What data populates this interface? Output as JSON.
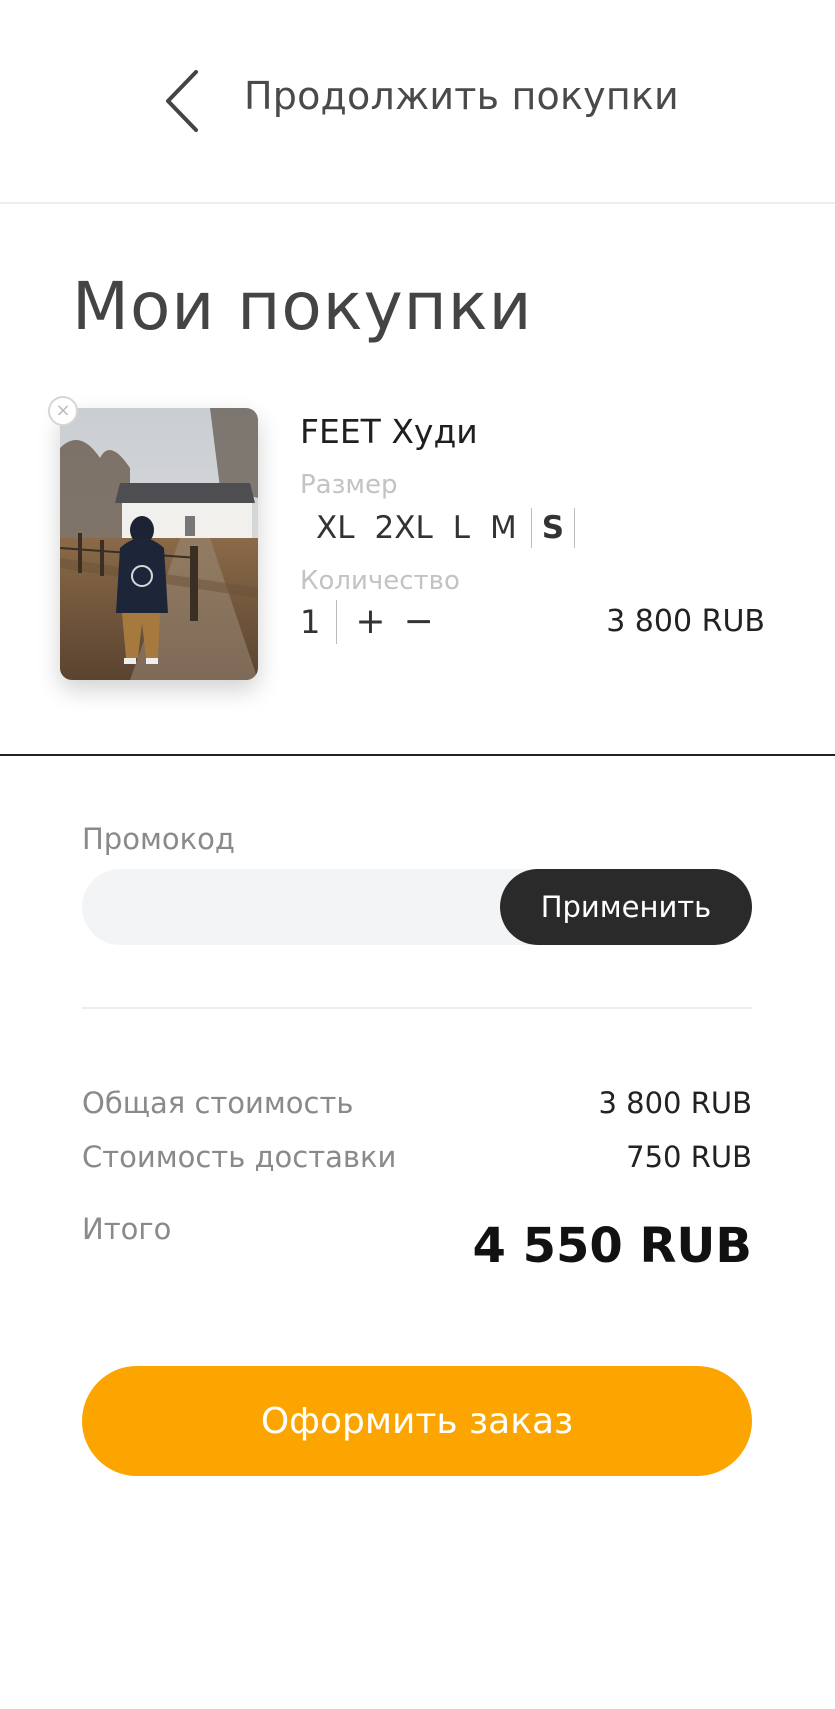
{
  "header": {
    "back_label": "Продолжить покупки"
  },
  "page_title": "Мои покупки",
  "cart_item": {
    "name": "FEET Худи",
    "size_label": "Размер",
    "sizes": [
      "XL",
      "2XL",
      "L",
      "M",
      "S"
    ],
    "selected_size": "S",
    "quantity_label": "Количество",
    "quantity": "1",
    "plus": "+",
    "minus": "−",
    "price": "3 800 RUB",
    "remove_icon": "close-icon"
  },
  "promo": {
    "label": "Промокод",
    "placeholder": "",
    "value": "",
    "apply_label": "Применить"
  },
  "summary": {
    "subtotal_label": "Общая стоимость",
    "subtotal_value": "3 800 RUB",
    "delivery_label": "Стоимость доставки",
    "delivery_value": "750 RUB",
    "total_label": "Итого",
    "total_value": "4 550 RUB"
  },
  "checkout_label": "Оформить заказ",
  "colors": {
    "accent": "#fca500",
    "dark_button": "#2a2a2a",
    "input_bg": "#f3f4f6"
  }
}
